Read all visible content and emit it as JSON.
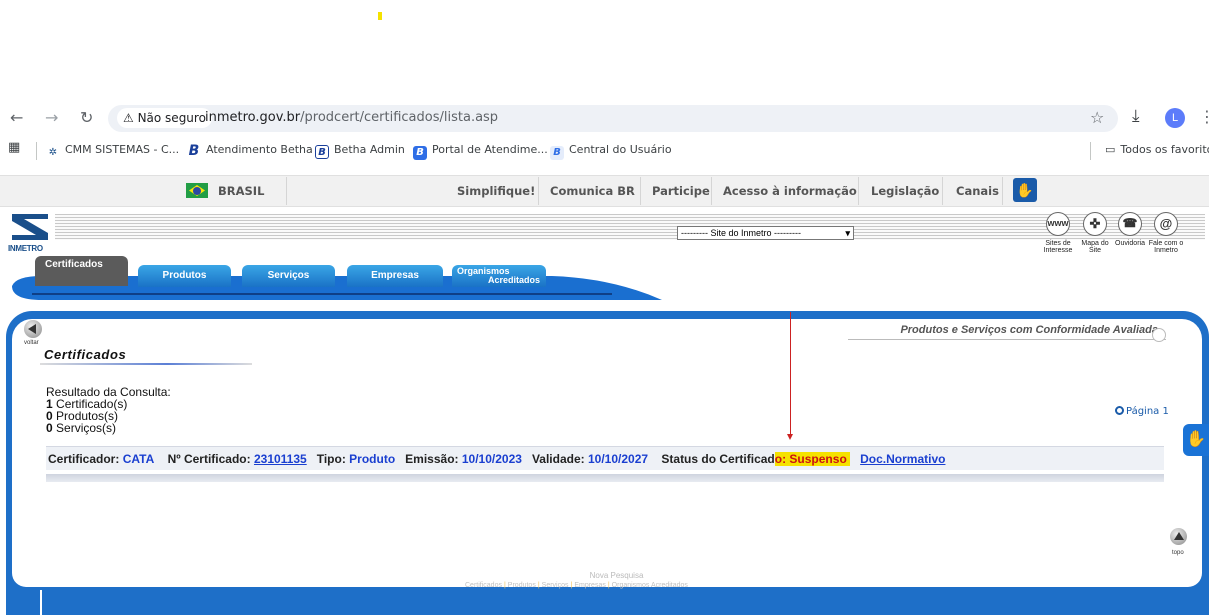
{
  "browser": {
    "security_label": "⚠ Não seguro",
    "url_host": "inmetro.gov.br",
    "url_path": "/prodcert/certificados/lista.asp",
    "profile_initial": "L"
  },
  "bookmarks": {
    "items": [
      {
        "label": "CMM SISTEMAS - C..."
      },
      {
        "label": "Atendimento Betha"
      },
      {
        "label": "Betha Admin"
      },
      {
        "label": "Portal de Atendime..."
      },
      {
        "label": "Central do Usuário"
      }
    ],
    "all_bookmarks": "Todos os favoritos"
  },
  "govbar": {
    "brasil": "BRASIL",
    "links": [
      "Simplifique!",
      "Comunica BR",
      "Participe",
      "Acesso à informação",
      "Legislação",
      "Canais"
    ]
  },
  "header": {
    "logo_text": "INMETRO",
    "site_select": "--------- Site do Inmetro ---------",
    "icons": [
      {
        "glyph": "www",
        "label": "Sites de Interesse"
      },
      {
        "glyph": "✜",
        "label": "Mapa do Site"
      },
      {
        "glyph": "☎",
        "label": "Ouvidoria"
      },
      {
        "glyph": "@",
        "label": "Fale com o Inmetro"
      }
    ]
  },
  "tabs": {
    "active": "Certificados",
    "items": [
      "Produtos",
      "Serviços",
      "Empresas"
    ],
    "org_line1": "Organismos",
    "org_line2": "Acreditados"
  },
  "main": {
    "voltar": "voltar",
    "title": "Certificados",
    "section_caption": "Produtos e Serviços com Conformidade Avaliada",
    "results_heading": "Resultado da Consulta:",
    "certificados_count": "1",
    "certificados_label": " Certificado(s)",
    "produtos_count": "0",
    "produtos_label": " Produtos(s)",
    "servicos_count": "0",
    "servicos_label": " Serviços(s)",
    "pagina": "Página 1",
    "certificate": {
      "certificador_label": "Certificador: ",
      "certificador": "CATA",
      "numero_label": "Nº Certificado: ",
      "numero": "23101135",
      "tipo_label": "Tipo: ",
      "tipo": "Produto",
      "emissao_label": "Emissão: ",
      "emissao": "10/10/2023",
      "validade_label": "Validade: ",
      "validade": "10/10/2027",
      "status_label": "Status do Certificad",
      "status_label_tail": "o",
      "status_value": ": Suspenso ",
      "doc_normativo": "Doc.Normativo"
    },
    "topo": "topo",
    "nova_pesquisa": "Nova Pesquisa",
    "footer_links": [
      "Certificados",
      "Produtos",
      "Serviços",
      "Empresas",
      "Organismos Acreditados"
    ]
  },
  "colors": {
    "panel_blue": "#1e6fc8",
    "status_highlight": "#f5e200",
    "link_blue": "#1a3fd0",
    "annotation_arrow": "#cc2222"
  }
}
